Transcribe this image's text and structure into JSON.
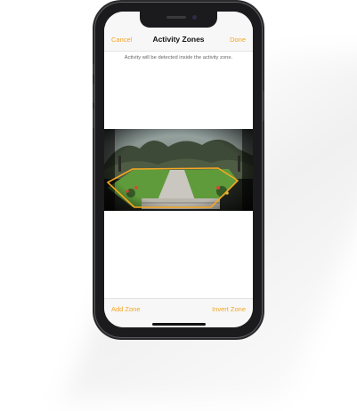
{
  "nav": {
    "cancel_label": "Cancel",
    "title": "Activity Zones",
    "done_label": "Done"
  },
  "hint_text": "Activity will be detected inside the activity zone.",
  "toolbar": {
    "add_zone_label": "Add Zone",
    "invert_zone_label": "Invert Zone"
  },
  "colors": {
    "accent": "#f5a623",
    "zone_outline": "#f5a623"
  }
}
